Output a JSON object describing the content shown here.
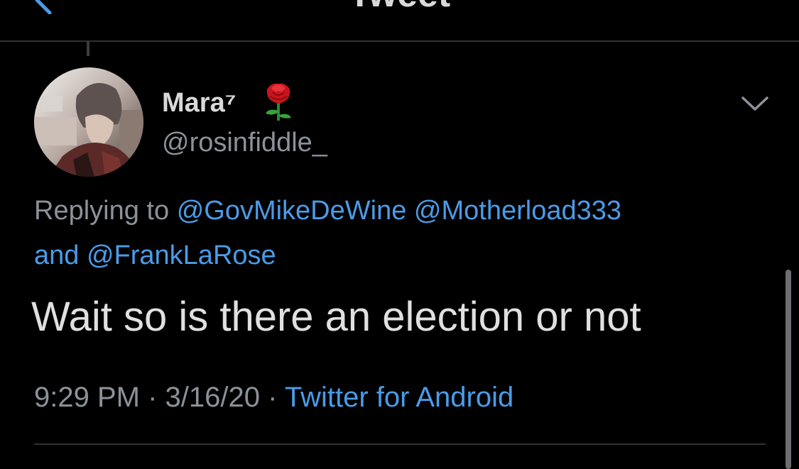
{
  "header": {
    "title": "Tweet",
    "back_icon": "chevron-left-icon"
  },
  "tweet": {
    "author": {
      "display_name": "Mara⁷",
      "emoji_icon": "rose-icon",
      "handle": "@rosinfiddle_"
    },
    "more_icon": "chevron-down-icon",
    "replying": {
      "prefix": "Replying to",
      "mention_1": "@GovMikeDeWine",
      "mention_2": "@Motherload333",
      "conjunction": "and",
      "mention_3": "@FrankLaRose"
    },
    "text": "Wait so is there an election or not",
    "meta": {
      "time": "9:29 PM",
      "separator": "·",
      "date": "3/16/20",
      "source": "Twitter for Android"
    }
  },
  "colors": {
    "background": "#000000",
    "accent": "#4b9be8",
    "muted": "#8b9299",
    "text": "#e0e0e0",
    "divider": "#2f3336"
  }
}
